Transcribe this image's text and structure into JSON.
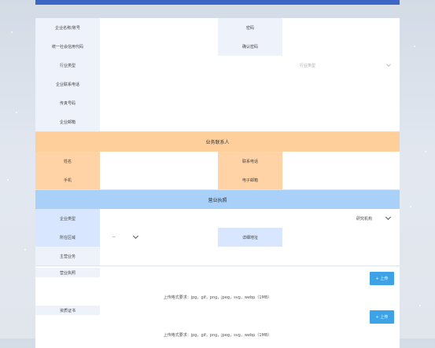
{
  "company": {
    "name_label": "企业名称/账号",
    "password_label": "密码",
    "credit_code_label": "统一社会信用代码",
    "confirm_password_label": "确认密码",
    "industry_label": "行业类型",
    "industry_placeholder": "行业类型",
    "phone_label": "企业联系电话",
    "fax_label": "传真号码",
    "email_label": "企业邮箱"
  },
  "contact": {
    "section_title": "业务联系人",
    "name_label": "姓名",
    "phone_label": "联系电话",
    "mobile_label": "手机",
    "email_label": "电子邮箱"
  },
  "license": {
    "section_title": "营业执照",
    "company_type_label": "企业类型",
    "company_type_value": "研究机构",
    "region_label": "所在区域",
    "region_value": "--",
    "address_label": "详细地址",
    "main_business_label": "主营业务",
    "business_license_label": "营业执照",
    "qualification_label": "资质证书",
    "upload_button": "+ 上传",
    "upload_hint": "上传格式要求：jpg，gif，png，jpeg，svg，webp（1MB）"
  }
}
